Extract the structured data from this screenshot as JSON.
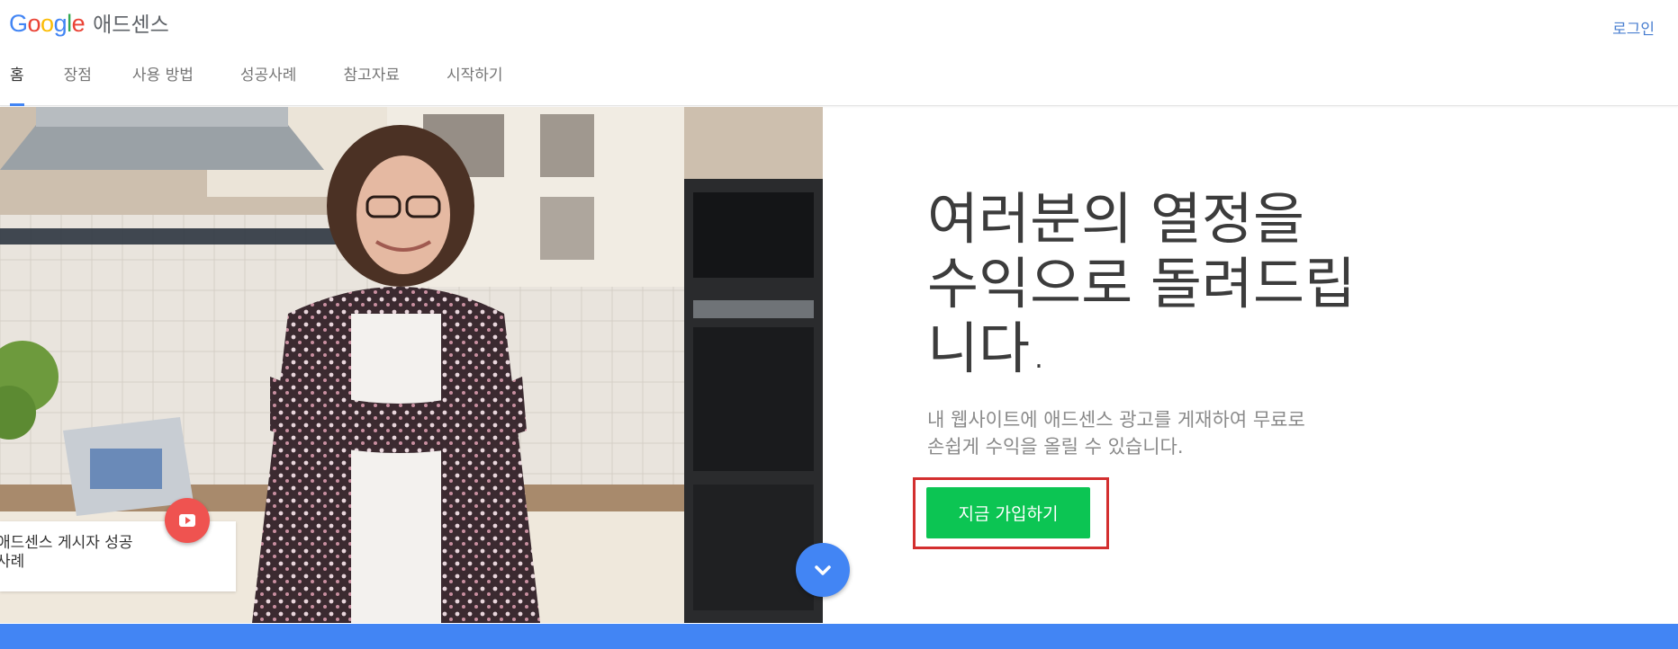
{
  "header": {
    "logo": {
      "google_letters": [
        "G",
        "o",
        "o",
        "g",
        "l",
        "e"
      ],
      "google_colors": [
        "#4285f4",
        "#ea4335",
        "#fbbc05",
        "#4285f4",
        "#34a853",
        "#ea4335"
      ],
      "product": "애드센스"
    },
    "login_label": "로그인",
    "nav": [
      {
        "label": "홈",
        "active": true
      },
      {
        "label": "장점",
        "active": false
      },
      {
        "label": "사용 방법",
        "active": false
      },
      {
        "label": "성공사례",
        "active": false
      },
      {
        "label": "참고자료",
        "active": false
      },
      {
        "label": "시작하기",
        "active": false
      }
    ]
  },
  "hero": {
    "headline": "여러분의 열정을\n수익으로 돌려드립\n니다.",
    "subtext": "내 웹사이트에 애드센스 광고를 게재하여 무료로\n손쉽게 수익을 올릴 수 있습니다.",
    "cta_label": "지금 가입하기"
  },
  "story_card": {
    "text": "애드센스 게시자 성공\n사례"
  },
  "icons": {
    "play": "youtube-play-icon",
    "scroll": "chevron-down-icon"
  },
  "colors": {
    "accent_blue": "#4285f4",
    "cta_green": "#0cc553",
    "highlight_red": "#d32f2f",
    "play_red": "#ef5350"
  }
}
